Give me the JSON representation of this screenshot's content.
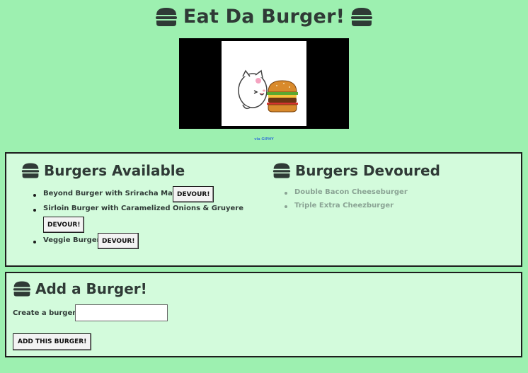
{
  "header": {
    "title": "Eat Da Burger!"
  },
  "gif": {
    "credit": "via GIPHY"
  },
  "available": {
    "title": "Burgers Available",
    "items": [
      {
        "name": "Beyond Burger with Sriracha Mayo",
        "button": "DEVOUR!"
      },
      {
        "name": "Sirloin Burger with Caramelized Onions & Gruyere",
        "button": "DEVOUR!"
      },
      {
        "name": "Veggie Burger",
        "button": "DEVOUR!"
      }
    ]
  },
  "devoured": {
    "title": "Burgers Devoured",
    "items": [
      {
        "name": "Double Bacon Cheeseburger"
      },
      {
        "name": "Triple Extra Cheezburger"
      }
    ]
  },
  "add": {
    "title": "Add a Burger!",
    "label": "Create a burger:",
    "input_value": "",
    "input_placeholder": "",
    "button": "ADD THIS BURGER!"
  },
  "icons": {
    "burger": "hamburger-icon"
  },
  "colors": {
    "background": "#9df0b0",
    "panel": "#d3fbdc",
    "text": "#2f3a36",
    "devoured_text": "#8aa394"
  }
}
